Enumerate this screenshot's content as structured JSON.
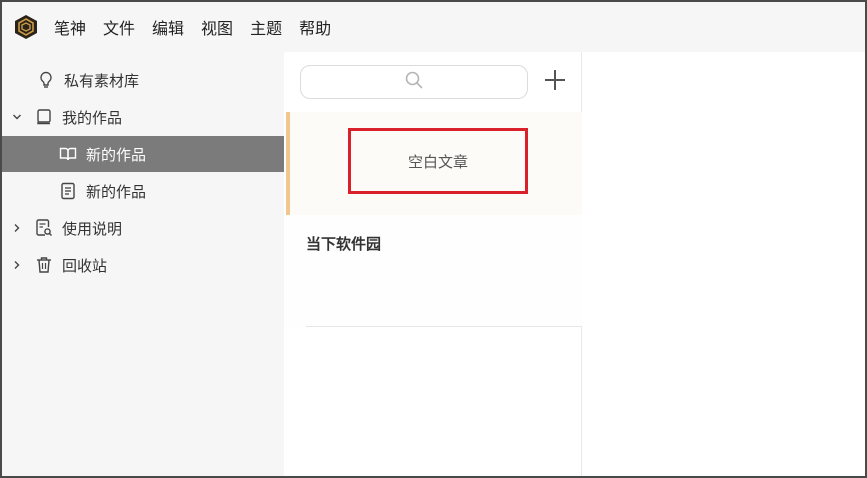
{
  "menubar": {
    "logo_icon": "app-logo-icon",
    "items": [
      "笔神",
      "文件",
      "编辑",
      "视图",
      "主题",
      "帮助"
    ]
  },
  "sidebar": {
    "items": [
      {
        "label": "私有素材库",
        "icon": "lightbulb-icon",
        "expander": "",
        "selected": false
      },
      {
        "label": "我的作品",
        "icon": "book-icon",
        "expander": "chevron-down-icon",
        "selected": false
      },
      {
        "label": "新的作品",
        "icon": "open-book-icon",
        "expander": "",
        "selected": true
      },
      {
        "label": "新的作品",
        "icon": "document-icon",
        "expander": "",
        "selected": false
      },
      {
        "label": "使用说明",
        "icon": "search-document-icon",
        "expander": "chevron-right-icon",
        "selected": false
      },
      {
        "label": "回收站",
        "icon": "trash-icon",
        "expander": "chevron-right-icon",
        "selected": false
      }
    ]
  },
  "list": {
    "search_icon": "search-icon",
    "add_icon": "plus-icon",
    "cards": [
      {
        "title": "空白文章",
        "selected": true
      },
      {
        "title": "当下软件园",
        "selected": false
      }
    ]
  },
  "colors": {
    "selected_row": "#7b7b7b",
    "selected_card_accent": "#f0c78e",
    "highlight_box": "#d9202b"
  }
}
